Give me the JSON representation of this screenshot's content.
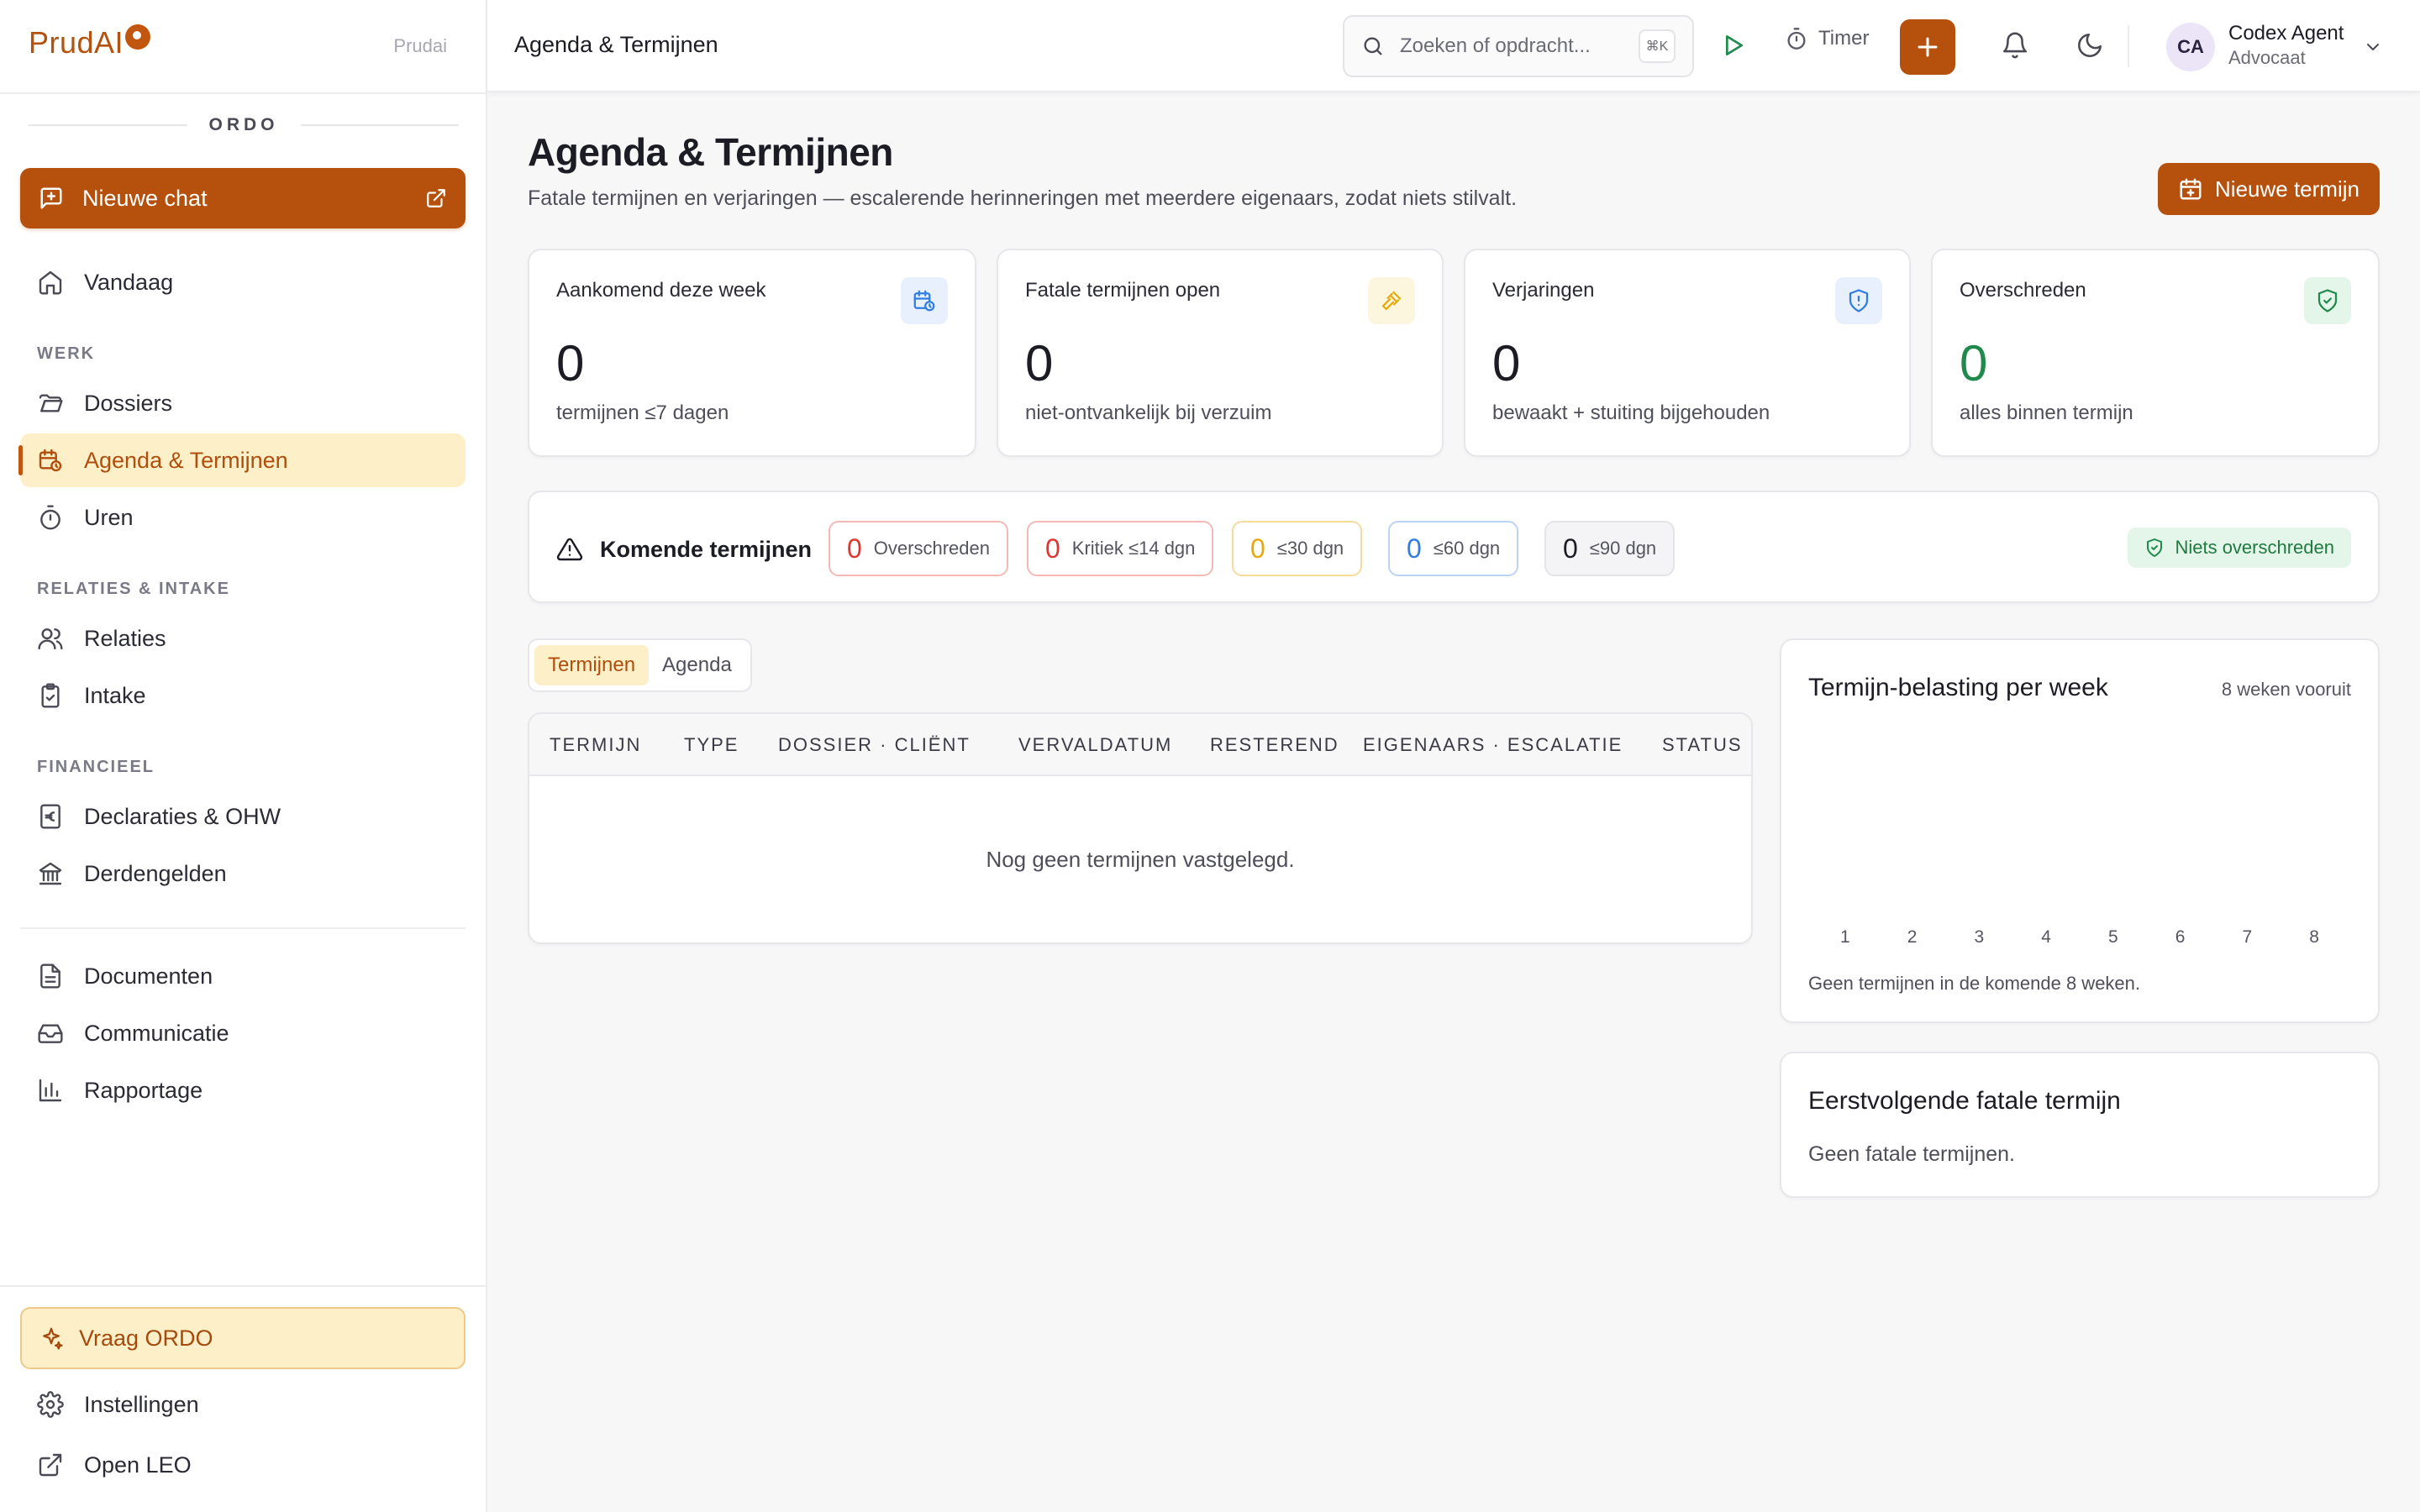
{
  "sidebar": {
    "brand": "PrudAI",
    "brand_sub": "Prudai",
    "section_title": "ORDO",
    "new_chat": "Nieuwe chat",
    "today": "Vandaag",
    "sections": {
      "werk": "WERK",
      "relaties": "RELATIES & INTAKE",
      "financieel": "FINANCIEEL"
    },
    "items": {
      "dossiers": "Dossiers",
      "agenda": "Agenda & Termijnen",
      "uren": "Uren",
      "relaties": "Relaties",
      "intake": "Intake",
      "declaraties": "Declaraties & OHW",
      "derdengelden": "Derdengelden",
      "documenten": "Documenten",
      "communicatie": "Communicatie",
      "rapportage": "Rapportage"
    },
    "vraag": "Vraag ORDO",
    "instellingen": "Instellingen",
    "open_leo": "Open LEO"
  },
  "topbar": {
    "title": "Agenda & Termijnen",
    "search_placeholder": "Zoeken of opdracht...",
    "shortcut": "⌘K",
    "timer": "Timer",
    "user": {
      "initials": "CA",
      "name": "Codex Agent",
      "role": "Advocaat"
    }
  },
  "page": {
    "title": "Agenda & Termijnen",
    "subtitle": "Fatale termijnen en verjaringen — escalerende herinneringen met meerdere eigenaars, zodat niets stilvalt.",
    "new_button": "Nieuwe termijn"
  },
  "stats": [
    {
      "title": "Aankomend deze week",
      "value": "0",
      "desc": "termijnen ≤7 dagen",
      "icon": "calendar-clock-icon",
      "color": "#1c1c24"
    },
    {
      "title": "Fatale termijnen open",
      "value": "0",
      "desc": "niet-ontvankelijk bij verzuim",
      "icon": "gavel-icon",
      "color": "#1c1c24"
    },
    {
      "title": "Verjaringen",
      "value": "0",
      "desc": "bewaakt + stuiting bijgehouden",
      "icon": "shield-alert-icon",
      "color": "#1c1c24"
    },
    {
      "title": "Overschreden",
      "value": "0",
      "desc": "alles binnen termijn",
      "icon": "shield-check-icon",
      "color": "#1f8a4c"
    }
  ],
  "upcoming": {
    "label": "Komende termijnen",
    "pills": [
      {
        "num": "0",
        "text": "Overschreden",
        "color": "#e0342e"
      },
      {
        "num": "0",
        "text": "Kritiek ≤14 dgn",
        "color": "#e0342e"
      },
      {
        "num": "0",
        "text": "≤30 dgn",
        "color": "#e3a90d"
      },
      {
        "num": "0",
        "text": "≤60 dgn",
        "color": "#2f7de1"
      },
      {
        "num": "0",
        "text": "≤90 dgn",
        "color": "#1c1c24"
      }
    ],
    "status": "Niets overschreden"
  },
  "tabs": [
    "Termijnen",
    "Agenda"
  ],
  "table": {
    "columns": [
      "TERMIJN",
      "TYPE",
      "DOSSIER · CLIËNT",
      "VERVALDATUM",
      "RESTEREND",
      "EIGENAARS · ESCALATIE",
      "STATUS"
    ],
    "empty": "Nog geen termijnen vastgelegd."
  },
  "chart_data": {
    "type": "bar",
    "title": "Termijn-belasting per week",
    "range_label": "8 weken vooruit",
    "categories": [
      "1",
      "2",
      "3",
      "4",
      "5",
      "6",
      "7",
      "8"
    ],
    "values": [
      0,
      0,
      0,
      0,
      0,
      0,
      0,
      0
    ],
    "note": "Geen termijnen in de komende 8 weken."
  },
  "fatal": {
    "title": "Eerstvolgende fatale termijn",
    "note": "Geen fatale termijnen."
  }
}
